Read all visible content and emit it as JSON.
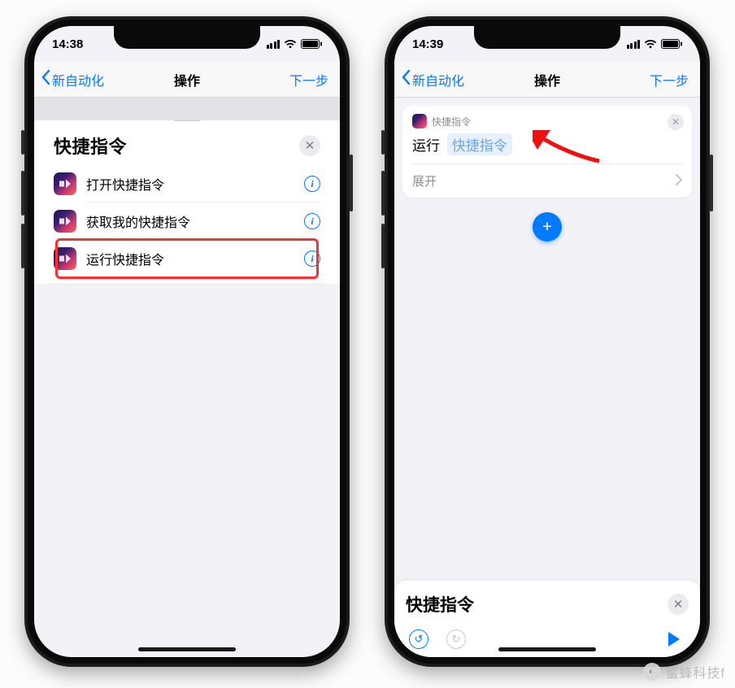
{
  "left": {
    "status_time": "14:38",
    "nav_back": "新自动化",
    "nav_title": "操作",
    "nav_next": "下一步",
    "panel_title": "快捷指令",
    "rows": [
      {
        "label": "打开快捷指令"
      },
      {
        "label": "获取我的快捷指令"
      },
      {
        "label": "运行快捷指令"
      }
    ]
  },
  "right": {
    "status_time": "14:39",
    "nav_back": "新自动化",
    "nav_title": "操作",
    "nav_next": "下一步",
    "card_app": "快捷指令",
    "card_action": "运行",
    "card_token": "快捷指令",
    "card_expand": "展开",
    "sheet_title": "快捷指令"
  },
  "plus_label": "+",
  "watermark": "蜜蜂科技f"
}
